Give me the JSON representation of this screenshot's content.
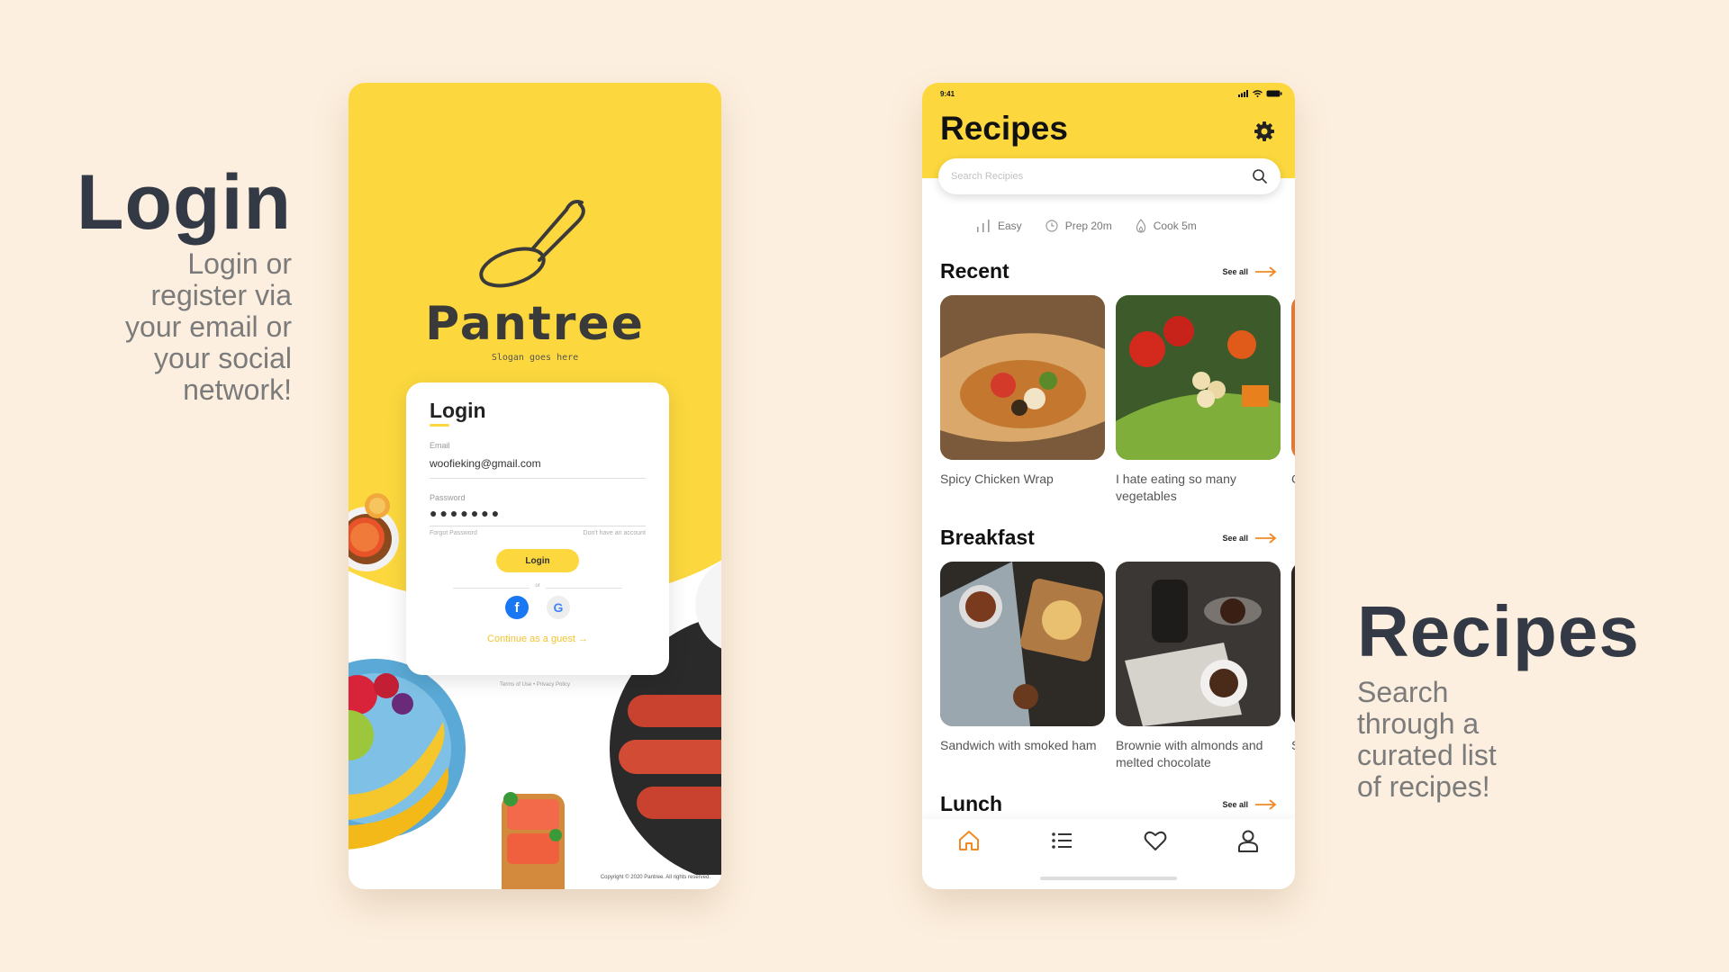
{
  "left_caption": {
    "title": "Login",
    "lines": [
      "Login or",
      "register via",
      "your email or",
      "your social",
      "network!"
    ]
  },
  "right_caption": {
    "title": "Recipes",
    "lines": [
      "Search",
      "through a",
      "curated list",
      "of recipes!"
    ]
  },
  "login_screen": {
    "brand": "Pantree",
    "slogan": "Slogan goes here",
    "card_title": "Login",
    "email_label": "Email",
    "email_value": "woofieking@gmail.com",
    "password_label": "Password",
    "password_mask": "●●●●●●●",
    "forgot_password": "Forgot Password",
    "no_account": "Don't have an account",
    "login_button": "Login",
    "or_text": "or",
    "facebook_glyph": "f",
    "google_glyph": "G",
    "guest_link": "Continue as a guest →",
    "terms": "Terms of Use  •  Privacy Policy",
    "copyright": "Copyright © 2020 Pantree. All rights reserved."
  },
  "recipes_screen": {
    "status_time": "9:41",
    "title": "Recipes",
    "search_placeholder": "Search Recipies",
    "filters": [
      {
        "icon": "difficulty-bars-icon",
        "label": "Easy"
      },
      {
        "icon": "clock-icon",
        "label": "Prep 20m"
      },
      {
        "icon": "flame-icon",
        "label": "Cook 5m"
      }
    ],
    "see_all": "See all",
    "sections": [
      {
        "title": "Recent",
        "cards": [
          {
            "label": "Spicy Chicken Wrap"
          },
          {
            "label": "I hate eating so many vegetables"
          },
          {
            "label": "C C"
          }
        ]
      },
      {
        "title": "Breakfast",
        "cards": [
          {
            "label": "Sandwich with smoked ham"
          },
          {
            "label": "Brownie with almonds and melted chocolate"
          },
          {
            "label": "S h"
          }
        ]
      },
      {
        "title": "Lunch",
        "cards": []
      }
    ],
    "tabs": [
      "home-icon",
      "list-icon",
      "heart-icon",
      "profile-icon"
    ]
  },
  "colors": {
    "background": "#fdefdf",
    "accent_yellow": "#fcd83e",
    "accent_orange": "#f08a24",
    "heading_dark": "#333a45"
  }
}
